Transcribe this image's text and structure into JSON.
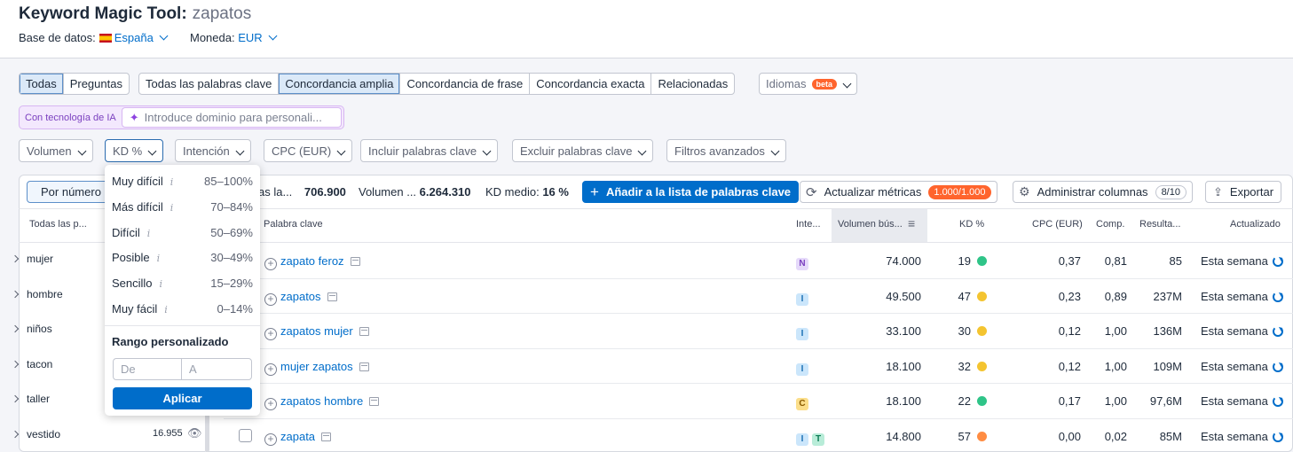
{
  "header": {
    "title": "Keyword Magic Tool:",
    "keyword": "zapatos",
    "database_label": "Base de datos:",
    "database_value": "España",
    "currency_label": "Moneda:",
    "currency_value": "EUR"
  },
  "match_tabs": [
    "Todas",
    "Preguntas"
  ],
  "match_type_tabs": [
    "Todas las palabras clave",
    "Concordancia amplia",
    "Concordancia de frase",
    "Concordancia exacta",
    "Relacionadas"
  ],
  "languages": {
    "label": "Idiomas",
    "badge": "beta"
  },
  "ai": {
    "label": "Con tecnología de IA",
    "placeholder": "Introduce dominio para personali..."
  },
  "filters": [
    "Volumen",
    "KD %",
    "Intención",
    "CPC (EUR)",
    "Incluir palabras clave",
    "Excluir palabras clave",
    "Filtros avanzados"
  ],
  "toolbar": {
    "group_by": "Por número",
    "all_words_label": "as la...",
    "all_words_value": "706.900",
    "volume_label": "Volumen ...",
    "volume_value": "6.264.310",
    "kd_label": "KD medio:",
    "kd_value": "16 %",
    "add_list": "Añadir a la lista de palabras clave",
    "update_metrics": "Actualizar métricas",
    "update_badge": "1.000/1.000",
    "manage_columns": "Administrar columnas",
    "columns_badge": "8/10",
    "export": "Exportar"
  },
  "sidebar": {
    "header": "Todas las p...",
    "items": [
      {
        "label": "mujer",
        "count": ""
      },
      {
        "label": "hombre",
        "count": ""
      },
      {
        "label": "niños",
        "count": ""
      },
      {
        "label": "tacon",
        "count": ""
      },
      {
        "label": "taller",
        "count": ""
      },
      {
        "label": "vestido",
        "count": "16.955"
      }
    ]
  },
  "kd_dropdown": {
    "options": [
      {
        "label": "Muy difícil",
        "range": "85–100%"
      },
      {
        "label": "Más difícil",
        "range": "70–84%"
      },
      {
        "label": "Difícil",
        "range": "50–69%"
      },
      {
        "label": "Posible",
        "range": "30–49%"
      },
      {
        "label": "Sencillo",
        "range": "15–29%"
      },
      {
        "label": "Muy fácil",
        "range": "0–14%"
      }
    ],
    "custom_range_title": "Rango personalizado",
    "from_placeholder": "De",
    "to_placeholder": "A",
    "apply": "Aplicar"
  },
  "table": {
    "columns": [
      "Palabra clave",
      "Inte...",
      "Volumen bús...",
      "KD %",
      "CPC (EUR)",
      "Comp.",
      "Resulta...",
      "Actualizado"
    ],
    "rows": [
      {
        "keyword": "zapato feroz",
        "intents": [
          "N"
        ],
        "volume": "74.000",
        "kd": "19",
        "kd_color": "#2fc488",
        "cpc": "0,37",
        "comp": "0,81",
        "results": "85",
        "updated": "Esta semana"
      },
      {
        "keyword": "zapatos",
        "intents": [
          "I"
        ],
        "volume": "49.500",
        "kd": "47",
        "kd_color": "#f4c430",
        "cpc": "0,23",
        "comp": "0,89",
        "results": "237M",
        "updated": "Esta semana"
      },
      {
        "keyword": "zapatos mujer",
        "intents": [
          "I"
        ],
        "volume": "33.100",
        "kd": "30",
        "kd_color": "#f4c430",
        "cpc": "0,12",
        "comp": "1,00",
        "results": "136M",
        "updated": "Esta semana"
      },
      {
        "keyword": "mujer zapatos",
        "intents": [
          "I"
        ],
        "volume": "18.100",
        "kd": "32",
        "kd_color": "#f4c430",
        "cpc": "0,12",
        "comp": "1,00",
        "results": "109M",
        "updated": "Esta semana"
      },
      {
        "keyword": "zapatos hombre",
        "intents": [
          "C"
        ],
        "volume": "18.100",
        "kd": "22",
        "kd_color": "#2fc488",
        "cpc": "0,17",
        "comp": "1,00",
        "results": "97,6M",
        "updated": "Esta semana"
      },
      {
        "keyword": "zapata",
        "intents": [
          "I",
          "T"
        ],
        "volume": "14.800",
        "kd": "57",
        "kd_color": "#ff8c42",
        "cpc": "0,00",
        "comp": "0,02",
        "results": "85M",
        "updated": "Esta semana"
      }
    ]
  },
  "colors": {
    "accent": "#006dca",
    "intent_N": "#e5d9fa",
    "intent_I": "#cbe6fb",
    "intent_C": "#fbde8a",
    "intent_T": "#b8ecd8"
  }
}
